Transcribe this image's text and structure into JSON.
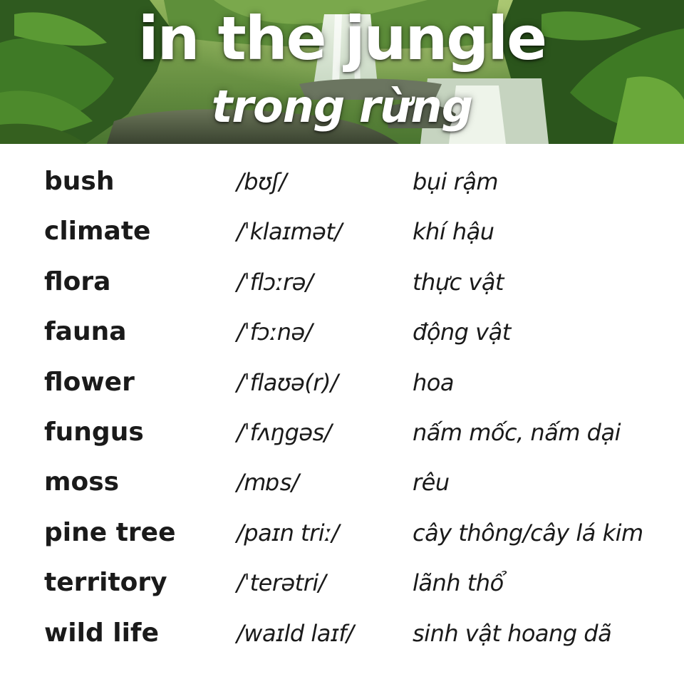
{
  "header": {
    "title": "in the jungle",
    "subtitle": "trong rừng",
    "background": "jungle-waterfall-photo"
  },
  "vocabulary": [
    {
      "word": "bush",
      "ipa": "/bʊʃ/",
      "meaning": "bụi rậm"
    },
    {
      "word": "climate",
      "ipa": "/ˈklaɪmət/",
      "meaning": "khí hậu"
    },
    {
      "word": "flora",
      "ipa": "/ˈflɔːrə/",
      "meaning": "thực vật"
    },
    {
      "word": "fauna",
      "ipa": "/ˈfɔːnə/",
      "meaning": "động vật"
    },
    {
      "word": "flower",
      "ipa": "/ˈflaʊə(r)/",
      "meaning": "hoa"
    },
    {
      "word": "fungus",
      "ipa": "/ˈfʌŋgəs/",
      "meaning": "nấm mốc, nấm dại"
    },
    {
      "word": "moss",
      "ipa": "/mɒs/",
      "meaning": "rêu"
    },
    {
      "word": "pine tree",
      "ipa": "/paɪn triː/",
      "meaning": "cây thông/cây lá kim"
    },
    {
      "word": "territory",
      "ipa": "/ˈterətri/",
      "meaning": "lãnh thổ"
    },
    {
      "word": "wild life",
      "ipa": "/waɪld laɪf/",
      "meaning": "sinh vật hoang dã"
    }
  ]
}
